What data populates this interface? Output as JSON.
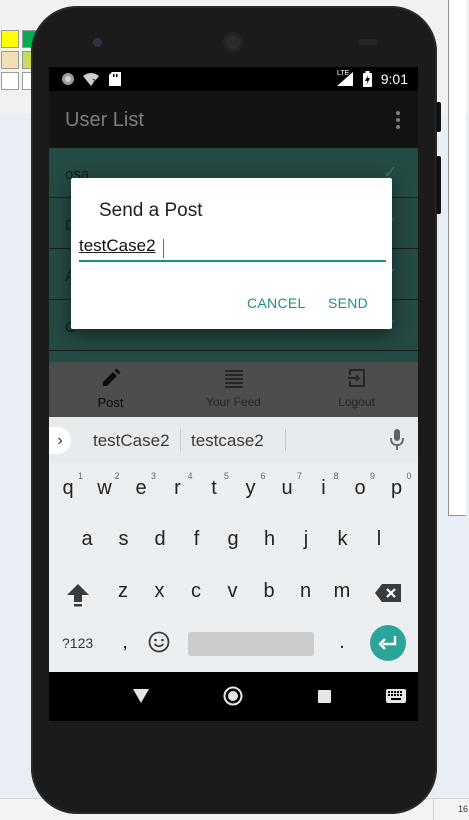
{
  "status_bar": {
    "time": "9:01",
    "network": "LTE"
  },
  "app_bar": {
    "title": "User List"
  },
  "list": {
    "items": [
      {
        "label": "osa"
      },
      {
        "label": "D"
      },
      {
        "label": "A"
      },
      {
        "label": "C"
      }
    ]
  },
  "dialog": {
    "title": "Send a Post",
    "input_value": "testCase2",
    "cancel_label": "CANCEL",
    "send_label": "SEND"
  },
  "bottom_nav": {
    "items": [
      {
        "label": "Post",
        "icon": "pencil-icon",
        "active": true
      },
      {
        "label": "Your Feed",
        "icon": "feed-icon",
        "active": false
      },
      {
        "label": "Logout",
        "icon": "logout-icon",
        "active": false
      }
    ]
  },
  "keyboard": {
    "suggestions": [
      "testCase2",
      "testcase2"
    ],
    "row1": [
      "q",
      "w",
      "e",
      "r",
      "t",
      "y",
      "u",
      "i",
      "o",
      "p"
    ],
    "row1_hints": [
      "1",
      "2",
      "3",
      "4",
      "5",
      "6",
      "7",
      "8",
      "9",
      "0"
    ],
    "row2": [
      "a",
      "s",
      "d",
      "f",
      "g",
      "h",
      "j",
      "k",
      "l"
    ],
    "row3": [
      "z",
      "x",
      "c",
      "v",
      "b",
      "n",
      "m"
    ],
    "symbols_label": "?123",
    "comma": ",",
    "period": "."
  },
  "background": {
    "status_text": "16"
  },
  "colors": {
    "accent": "#1a9185",
    "list_bg": "#244a44",
    "enter_key": "#2ba49a"
  }
}
